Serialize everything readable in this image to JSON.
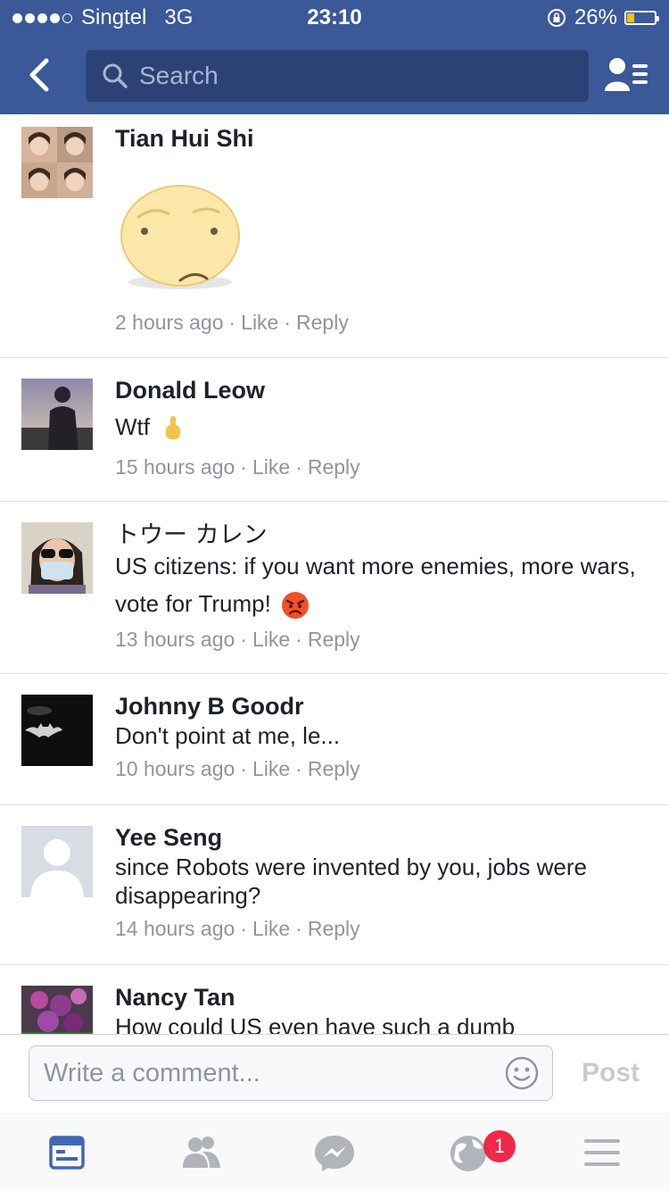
{
  "status_bar": {
    "carrier": "Singtel",
    "network": "3G",
    "time": "23:10",
    "battery": "26%",
    "battery_level": 0.26
  },
  "nav": {
    "search_placeholder": "Search"
  },
  "comments": [
    {
      "name": "Tian Hui Shi",
      "text": "",
      "time": "2 hours ago",
      "like": "Like",
      "reply": "Reply"
    },
    {
      "name": "Donald Leow",
      "text": "Wtf",
      "time": "15 hours ago",
      "like": "Like",
      "reply": "Reply"
    },
    {
      "name": "トウー カレン",
      "text": "US citizens: if you want more enemies, more wars, vote for Trump!",
      "time": "13 hours ago",
      "like": "Like",
      "reply": "Reply"
    },
    {
      "name": "Johnny B Goodr",
      "text": "Don't point at me, le...",
      "time": "10 hours ago",
      "like": "Like",
      "reply": "Reply"
    },
    {
      "name": "Yee Seng",
      "text": "since Robots were invented by you, jobs were disappearing?",
      "time": "14 hours ago",
      "like": "Like",
      "reply": "Reply"
    },
    {
      "name": "Nancy Tan",
      "text": "How could US even have such a dumb",
      "time": "",
      "like": "",
      "reply": ""
    }
  ],
  "composer": {
    "placeholder": "Write a comment...",
    "post_label": "Post"
  },
  "tabbar": {
    "notification_count": "1",
    "icons": [
      "news-feed-icon",
      "friend-requests-icon",
      "messenger-icon",
      "notifications-globe-icon",
      "menu-icon"
    ]
  },
  "colors": {
    "brand": "#3b5998",
    "badge": "#f02849",
    "text_secondary": "#90949c"
  }
}
